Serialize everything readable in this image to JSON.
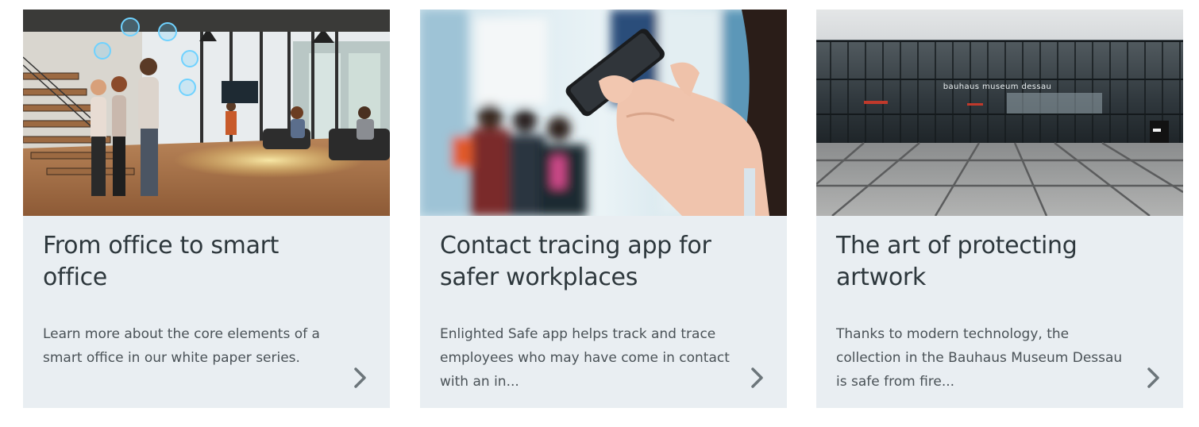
{
  "cards": [
    {
      "title": "From office to smart office",
      "description": "Learn more about the core elements of a smart office in our white paper series."
    },
    {
      "title": "Contact tracing app for safer workplaces",
      "description": "Enlighted Safe app helps track and trace employees who may have come in contact with an in..."
    },
    {
      "title": "The art of protecting artwork",
      "description": "Thanks to modern technology, the collection in the Bauhaus Museum Dessau is safe from fire...",
      "image_sign_text": "bauhaus museum dessau"
    }
  ],
  "colors": {
    "card_background": "#e9eef2",
    "title_text": "#2d373c",
    "body_text": "#4a5257",
    "arrow": "#6c757a",
    "page_background": "#ffffff"
  },
  "icons": {
    "card_link": "chevron-right-icon"
  }
}
